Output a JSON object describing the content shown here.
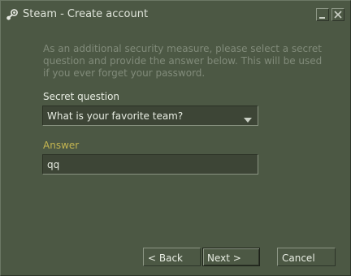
{
  "window": {
    "title": "Steam - Create account",
    "icons": {
      "app": "steam-logo-icon",
      "minimize": "minimize-icon",
      "close": "close-icon"
    }
  },
  "intro": {
    "lines": [
      "As an additional security measure, please select a secret",
      "question and provide the answer below. This will be used",
      "if you ever forget your password."
    ]
  },
  "secret_question": {
    "label": "Secret question",
    "selected": "What is your favorite team?",
    "arrow_icon": "dropdown-arrow-icon"
  },
  "answer": {
    "label": "Answer",
    "value": "qq"
  },
  "buttons": {
    "back": "< Back",
    "next": "Next >",
    "cancel": "Cancel"
  },
  "colors": {
    "background": "#4c5844",
    "field_bg": "#3d4536",
    "intro_text": "#818b7a",
    "answer_label": "#c4b550",
    "text": "#e8ede3"
  }
}
